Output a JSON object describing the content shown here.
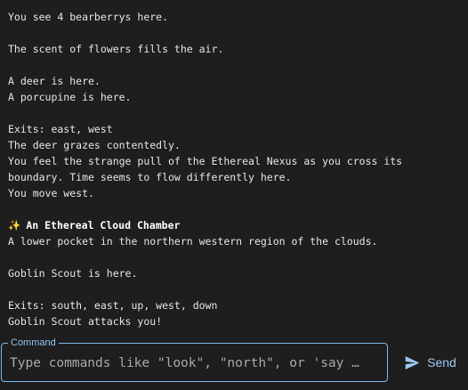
{
  "log": [
    "You see 4 bearberrys here.",
    "",
    "The scent of flowers fills the air.",
    "",
    "A deer is here.",
    "A porcupine is here.",
    "",
    "Exits: east, west",
    "The deer grazes contentedly.",
    "You feel the strange pull of the Ethereal Nexus as you cross its",
    "boundary. Time seems to flow differently here.",
    "You move west.",
    "",
    "",
    "A lower pocket in the northern western region of the clouds.",
    "",
    "Goblin Scout is here.",
    "",
    "Exits: south, east, up, west, down",
    "Goblin Scout attacks you!"
  ],
  "room": {
    "icon": "sparkles-icon",
    "icon_glyph": "✨",
    "title": "An Ethereal Cloud Chamber"
  },
  "command": {
    "legend": "Command",
    "placeholder": "Type commands like \"look\", \"north\", or 'say …",
    "value": ""
  },
  "send": {
    "icon": "send-icon",
    "label": "Send",
    "color": "#9cc9f3"
  },
  "colors": {
    "background": "#1e1e1e",
    "text": "#e6e6e6",
    "accent": "#7fb4e6"
  }
}
